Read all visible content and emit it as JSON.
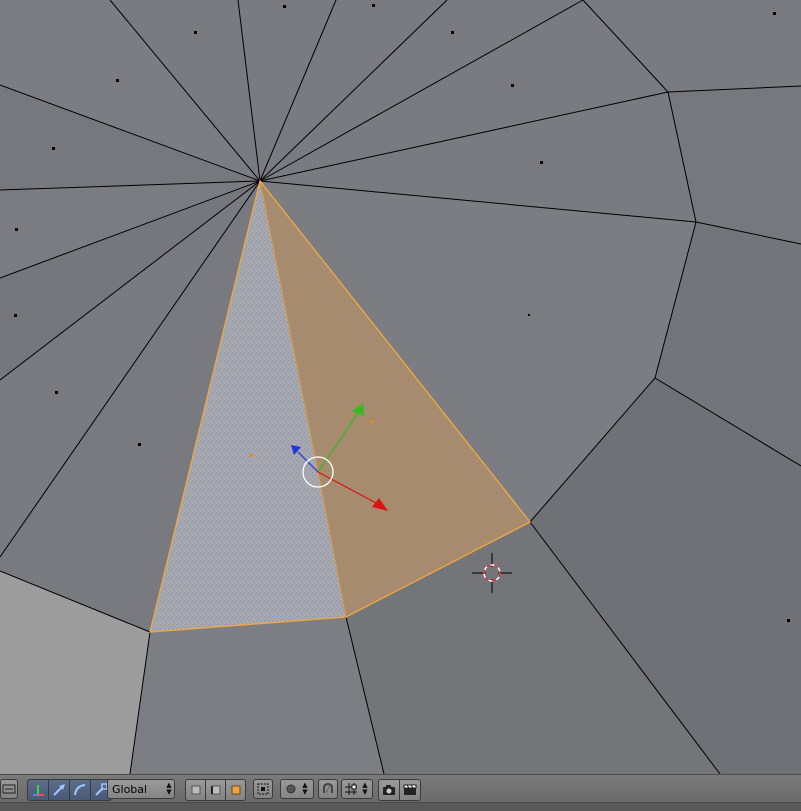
{
  "toolbar": {
    "transform_orientation": "Global"
  },
  "icons": {
    "editor_type": "editor-type-icon",
    "manipulator": "manipulator-icon",
    "translate": "translate-icon",
    "rotate": "rotate-icon",
    "scale": "scale-icon",
    "vertex_select": "vertex-select-icon",
    "edge_select": "edge-select-icon",
    "face_select": "face-select-icon",
    "occlude": "occlude-geometry-icon",
    "proportional": "proportional-editing-icon",
    "snap": "snap-icon",
    "snap_element": "snap-element-icon",
    "render": "opengl-render-icon",
    "render_anim": "opengl-render-animation-icon"
  },
  "colors": {
    "selected_edge": "#f3a73e",
    "active_face": "#a68b6e",
    "selected_face": "#a6a8b2",
    "mesh_face": "#797a80",
    "light_face": "#9c9c9c",
    "axis_x": "#dd1111",
    "axis_y": "#33bb22",
    "axis_z": "#2233dd"
  }
}
